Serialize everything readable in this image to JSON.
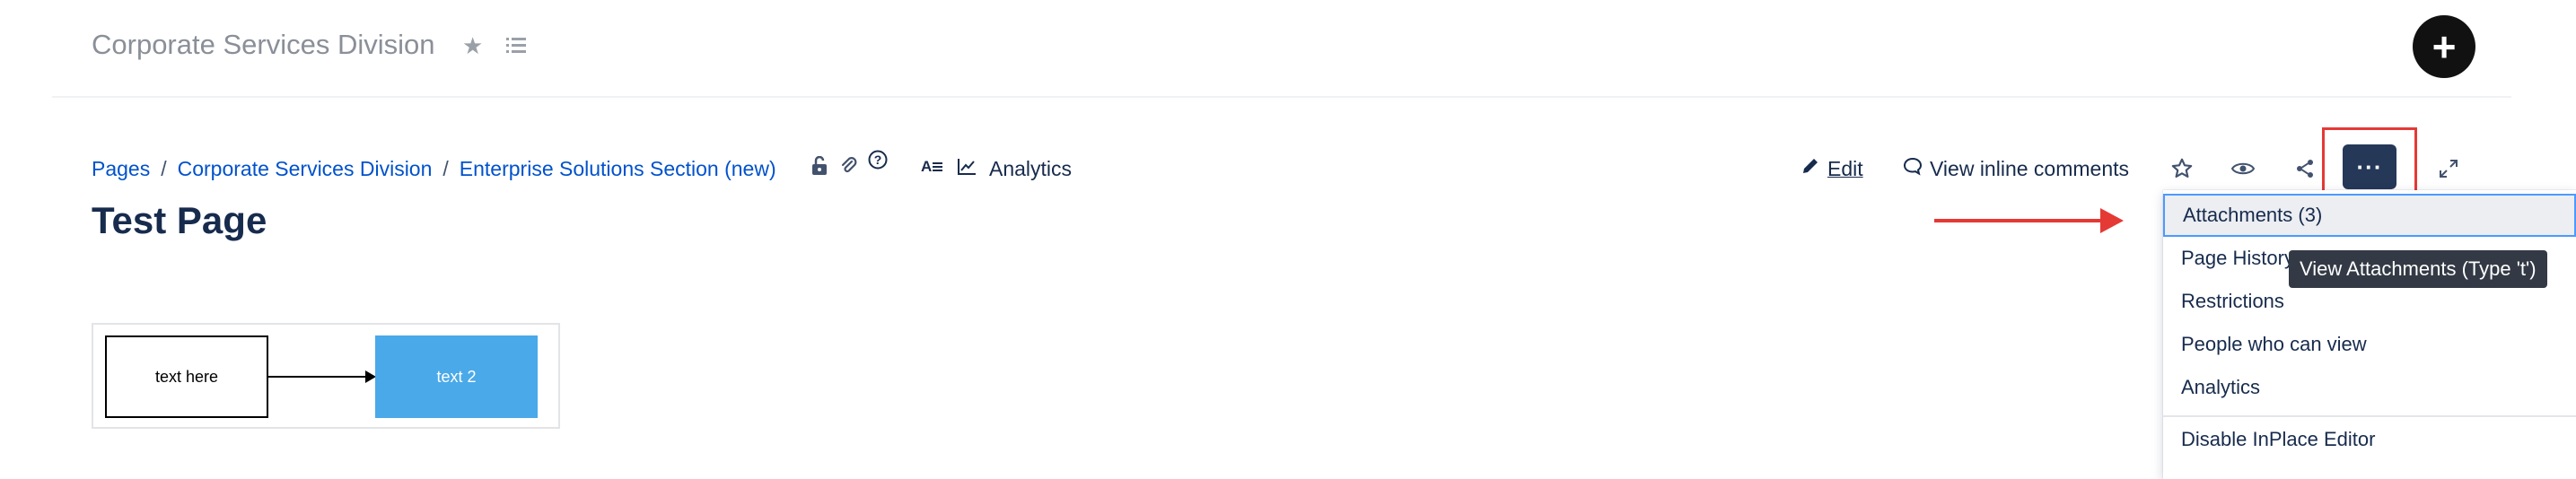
{
  "space": {
    "title": "Corporate Services Division"
  },
  "create_button": {
    "label": "+"
  },
  "breadcrumb": {
    "items": [
      "Pages",
      "Corporate Services Division",
      "Enterprise Solutions Section (new)"
    ],
    "separator": "/"
  },
  "analytics": {
    "label": "Analytics"
  },
  "page": {
    "title": "Test Page"
  },
  "toolbar": {
    "edit_label": "Edit",
    "comments_label": "View inline comments",
    "more_label": "···"
  },
  "more_menu": {
    "items": [
      "Attachments (3)",
      "Page History",
      "Restrictions",
      "People who can view",
      "Analytics"
    ],
    "footer_item": "Disable InPlace Editor"
  },
  "tooltip": {
    "text": "View Attachments (Type 't')"
  },
  "diagram": {
    "box1_text": "text here",
    "box2_text": "text 2",
    "box2_color": "#4aa9e8"
  },
  "colors": {
    "link": "#0052cc",
    "accent": "#253858",
    "annotation": "#e53935"
  }
}
